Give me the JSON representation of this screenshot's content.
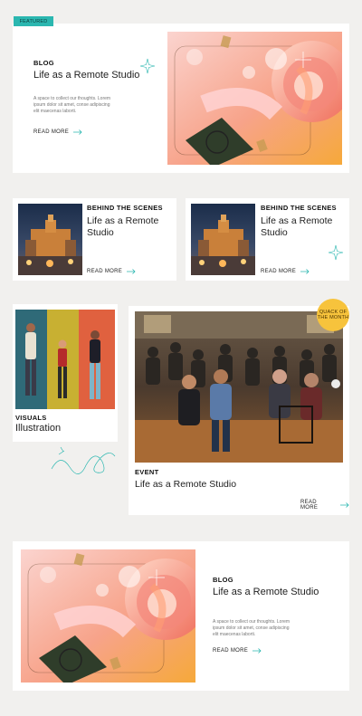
{
  "featured": {
    "tag": "FEATURED",
    "category": "BLOG",
    "title": "Life as a Remote Studio",
    "description": "A space to collect our thoughts. Lorem ipsum dolor sit amet, conse adipiscing elit maecenas laborti.",
    "read_more": "READ MORE"
  },
  "small_cards": [
    {
      "category": "BEHIND THE SCENES",
      "title": "Life as a Remote Studio",
      "read_more": "READ MORE"
    },
    {
      "category": "BEHIND THE SCENES",
      "title": "Life as a Remote Studio",
      "read_more": "READ MORE"
    }
  ],
  "visuals_card": {
    "category": "VISUALS",
    "title": "Illustration"
  },
  "event_card": {
    "badge": "QUACK OF THE MONTH",
    "category": "EVENT",
    "title": "Life as a Remote Studio",
    "read_more": "READ MORE"
  },
  "bottom_card": {
    "category": "BLOG",
    "title": "Life as a Remote Studio",
    "description": "A space to collect our thoughts. Lorem ipsum dolor sit amet, conse adipiscing elit maecenas laborti.",
    "read_more": "READ MORE"
  },
  "colors": {
    "background": "#f1f0ee",
    "card": "#ffffff",
    "accent_teal": "#2bb7b0",
    "badge_yellow": "#f7c33c"
  }
}
